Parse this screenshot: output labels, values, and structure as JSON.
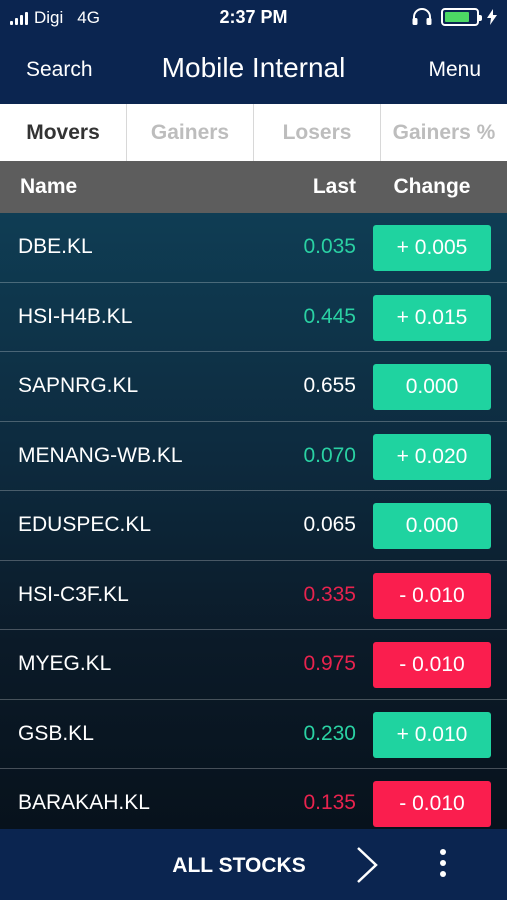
{
  "statusbar": {
    "carrier": "Digi",
    "network": "4G",
    "time": "2:37 PM",
    "icons": [
      "signal-icon",
      "headphones-icon",
      "battery-icon",
      "charging-bolt-icon"
    ],
    "battery_color": "#4cd964",
    "battery_level": 0.8
  },
  "navbar": {
    "left": "Search",
    "title": "Mobile Internal",
    "right": "Menu"
  },
  "tabs": [
    {
      "label": "Movers",
      "active": true
    },
    {
      "label": "Gainers",
      "active": false
    },
    {
      "label": "Losers",
      "active": false
    },
    {
      "label": "Gainers %",
      "active": false
    }
  ],
  "columns": {
    "name": "Name",
    "last": "Last",
    "change": "Change"
  },
  "colors": {
    "up": "#1fd3a0",
    "down": "#fa1e4e",
    "up_text": "#2ad1a3",
    "down_text": "#e8234e",
    "neutral_text": "#ffffff",
    "header_bg": "#0b2550"
  },
  "rows": [
    {
      "name": "DBE.KL",
      "last": "0.035",
      "change": "+ 0.005",
      "dir": "up"
    },
    {
      "name": "HSI-H4B.KL",
      "last": "0.445",
      "change": "+ 0.015",
      "dir": "up"
    },
    {
      "name": "SAPNRG.KL",
      "last": "0.655",
      "change": "0.000",
      "dir": "flat"
    },
    {
      "name": "MENANG-WB.KL",
      "last": "0.070",
      "change": "+ 0.020",
      "dir": "up"
    },
    {
      "name": "EDUSPEC.KL",
      "last": "0.065",
      "change": "0.000",
      "dir": "flat"
    },
    {
      "name": "HSI-C3F.KL",
      "last": "0.335",
      "change": "- 0.010",
      "dir": "down"
    },
    {
      "name": "MYEG.KL",
      "last": "0.975",
      "change": "- 0.010",
      "dir": "down"
    },
    {
      "name": "GSB.KL",
      "last": "0.230",
      "change": "+ 0.010",
      "dir": "up"
    },
    {
      "name": "BARAKAH.KL",
      "last": "0.135",
      "change": "- 0.010",
      "dir": "down"
    }
  ],
  "bottombar": {
    "label": "ALL STOCKS",
    "icons": [
      "chevron-right-icon",
      "more-vertical-icon"
    ]
  }
}
